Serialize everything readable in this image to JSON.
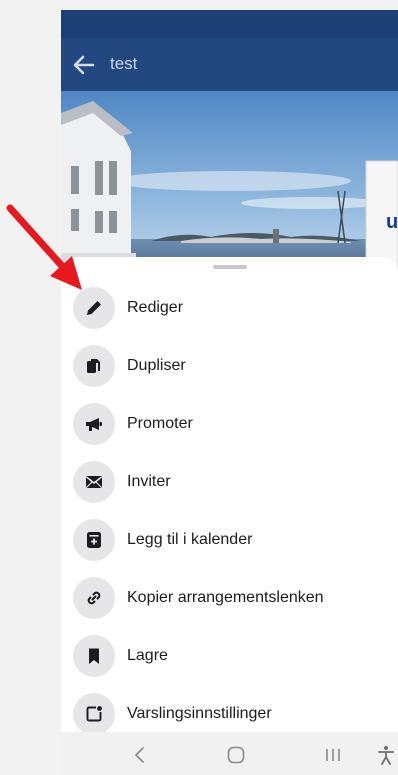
{
  "app_bar": {
    "title": "test",
    "back_icon": "arrow-left-icon"
  },
  "sheet": {
    "items": [
      {
        "label": "Rediger",
        "icon": "pencil-icon"
      },
      {
        "label": "Dupliser",
        "icon": "copy-icon"
      },
      {
        "label": "Promoter",
        "icon": "megaphone-icon"
      },
      {
        "label": "Inviter",
        "icon": "envelope-icon"
      },
      {
        "label": "Legg til i kalender",
        "icon": "calendar-add-icon"
      },
      {
        "label": "Kopier arrangementslenken",
        "icon": "link-icon"
      },
      {
        "label": "Lagre",
        "icon": "bookmark-icon"
      },
      {
        "label": "Varslingsinnstillinger",
        "icon": "notification-settings-icon"
      }
    ]
  },
  "nav_bar": {
    "buttons": [
      "back-chevron-icon",
      "home-icon",
      "recents-icon",
      "accessibility-icon"
    ]
  },
  "colors": {
    "app_bar": "#23477f",
    "status_bar": "#1d3f76",
    "icon_circle": "#e6e6e9",
    "annotation_arrow": "#e8191e"
  }
}
